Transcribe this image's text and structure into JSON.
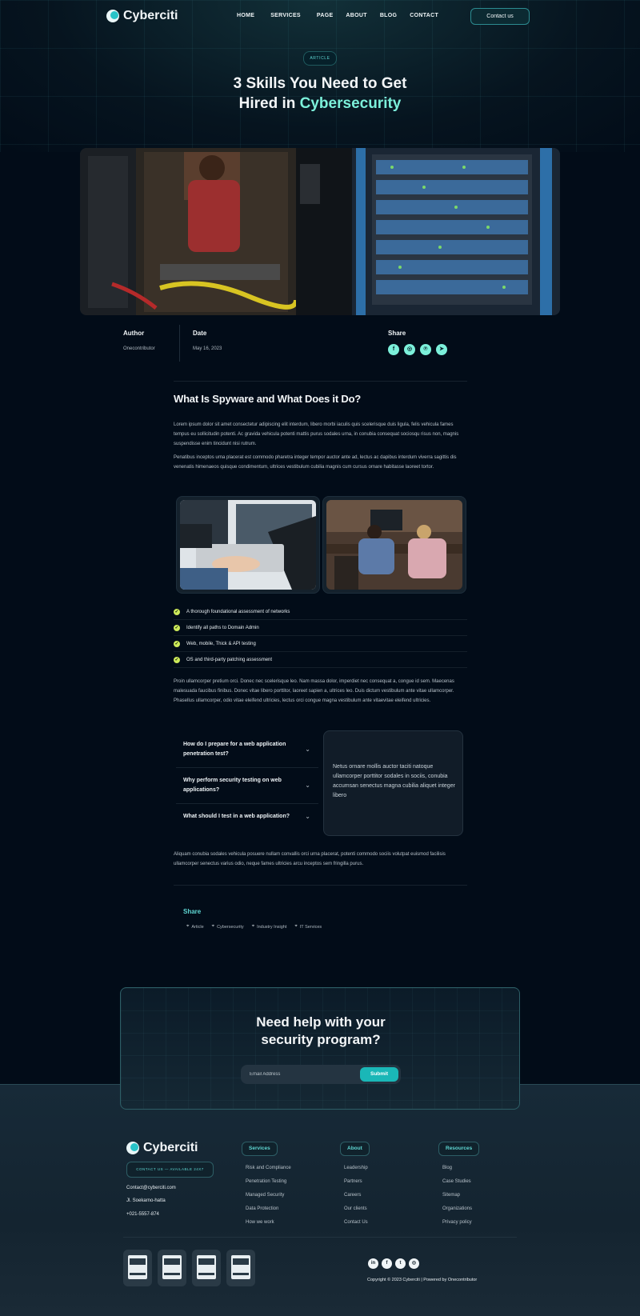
{
  "header": {
    "logo_text": "Cyberciti",
    "menu": [
      "HOME",
      "SERVICES",
      "PAGE",
      "ABOUT",
      "BLOG",
      "CONTACT"
    ],
    "contact_button": "Contact us"
  },
  "hero": {
    "pill": "ARTICLE",
    "title_line1": "3 Skills You Need to Get",
    "title_line2_plain": "Hired in ",
    "title_line2_accent": "Cybersecurity"
  },
  "meta": {
    "author_label": "Author",
    "author_value": "Onecontributor",
    "date_label": "Date",
    "date_value": "May 16, 2023",
    "share_label": "Share",
    "share_icons": [
      "facebook-icon",
      "instagram-icon",
      "pinterest-icon",
      "telegram-icon"
    ]
  },
  "article": {
    "heading": "What Is Spyware and What Does it Do?",
    "para1": "Lorem ipsum dolor sit amet consectetur adipiscing elit interdum, libero morbi iaculis quis scelerisque duis ligula, felis vehicula fames tempus eu sollicitudin potenti. Ac gravida vehicula potenti mattis purus sodales urna, in conubia consequat sociosqu risus non, magnis suspendisse enim tincidunt nisi rutrum.",
    "para2": "Penatibus inceptos urna placerat est commodo pharetra integer tempor auctor ante ad, lectus ac dapibus interdum viverra sagittis dis venenatis himenaeos quisque condimentum, ultrices vestibulum cubilia magnis cum cursus ornare habitasse laoreet tortor.",
    "checklist": [
      "A thorough foundational assessment of networks",
      "Identify all paths to Domain Admin",
      "Web, mobile, Thick & API testing",
      "OS and third-party patching assessment"
    ],
    "para3": "Proin ullamcorper pretium orci. Donec nec scelerisque leo. Nam massa dolor, imperdiet nec consequat a, congue id sem. Maecenas malesuada faucibus finibus. Donec vitae libero porttitor, laoreet sapien a, ultrices leo. Duis dictum vestibulum ante vitae ullamcorper. Phasellus ullamcorper, odio vitae eleifend ultricies, lectus orci congue magna vestibulum ante vitaevitae eleifend ultricies.",
    "faq": [
      "How do I prepare for a web application penetration test?",
      "Why perform security testing on web applications?",
      "What should I test in a web application?"
    ],
    "faq_card_text": "Netus ornare mollis auctor taciti natoque ullamcorper porttitor sodales in sociis, conubia accumsan senectus magna cubilia aliquet integer libero",
    "para4": "Aliquam conubia sodales vehicula posuere nullam convallis orci urna placerat, potenti commodo sociis volutpat euismod facilisis ullamcorper senectus varius odio, neque fames ultricies arcu inceptos sem fringilla purus.",
    "share_label": "Share",
    "tags": [
      "Article",
      "Cybersecurity",
      "Industry Insight",
      "IT Services"
    ]
  },
  "cta": {
    "title_line1": "Need help with your",
    "title_line2": "security program?",
    "email_placeholder": "Email Address",
    "submit_label": "Submit"
  },
  "footer": {
    "logo_text": "Cyberciti",
    "availability": "CONTACT US — AVAILABLE 24X7",
    "email": "Contact@cyberciti.com",
    "address": "Jl. Soekarno-hatta",
    "phone": "+021-5557-874",
    "columns": [
      {
        "title": "Services",
        "links": [
          "Risk and Compliance",
          "Penetration Testing",
          "Managed Security",
          "Data Protection",
          "How we work"
        ]
      },
      {
        "title": "About",
        "links": [
          "Leadership",
          "Partners",
          "Careers",
          "Our clients",
          "Contact Us"
        ]
      },
      {
        "title": "Resources",
        "links": [
          "Blog",
          "Case Studies",
          "Sitemap",
          "Organizations",
          "Privacy policy"
        ]
      }
    ],
    "social_icons": [
      "linkedin-icon",
      "facebook-icon",
      "twitter-icon",
      "instagram-icon"
    ],
    "copyright": "Copyright © 2023 Cyberciti | Powered by Onecontributor"
  },
  "colors": {
    "accent": "#7cf0da",
    "teal": "#1ab7b7",
    "background": "#020c18",
    "check": "#cdea5a"
  }
}
